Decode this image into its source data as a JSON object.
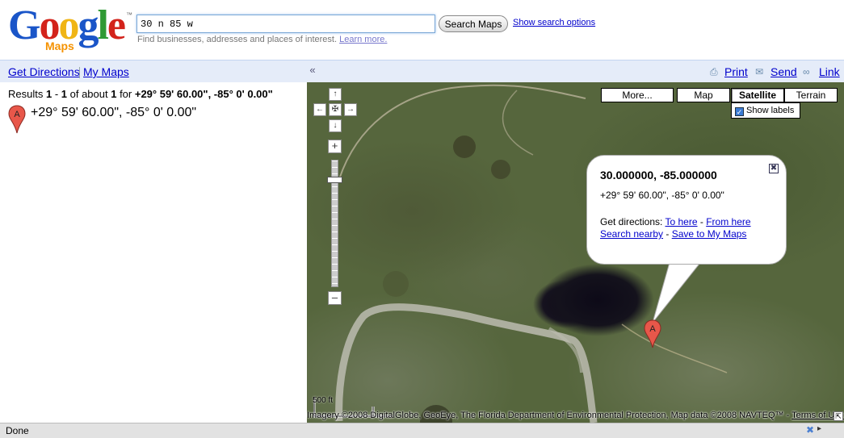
{
  "logo": {
    "text_letters": [
      "G",
      "o",
      "o",
      "g",
      "l",
      "e"
    ],
    "subtitle": "Maps",
    "trademark": "™"
  },
  "search": {
    "value": "30 n 85 w",
    "button_label": "Search Maps",
    "options_link": "Show search options",
    "hint": "Find businesses, addresses and places of interest.",
    "hint_link": "Learn more."
  },
  "left_bar": {
    "directions": "Get Directions",
    "my_maps": "My Maps"
  },
  "right_bar": {
    "collapse": "«",
    "print": "Print",
    "send": "Send",
    "link": "Link"
  },
  "results": {
    "prefix": "Results ",
    "start": "1",
    "dash": " - ",
    "end": "1",
    "middle": " of about ",
    "total": "1",
    "for_text": " for ",
    "query": "+29° 59' 60.00\", -85° 0' 0.00\"",
    "marker_letter": "A",
    "item_text": "+29° 59' 60.00\", -85° 0' 0.00\""
  },
  "map": {
    "types": {
      "more": "More...",
      "map": "Map",
      "satellite": "Satellite",
      "terrain": "Terrain"
    },
    "show_labels": "Show labels",
    "marker_letter": "A",
    "bubble": {
      "title": "30.000000, -85.000000",
      "coords": "+29° 59' 60.00\", -85° 0' 0.00\"",
      "get_directions": "Get directions: ",
      "to_here": "To here",
      "from_here": "From here",
      "search_nearby": "Search nearby",
      "save": "Save to My Maps",
      "sep": " - "
    },
    "scale_label": "500 ft",
    "copyright": "Imagery ©2008 DigitalGlobe, GeoEye, The Florida Department of Environmental Protection, Map data ©2008 NAVTEQ™ - ",
    "terms": "Terms of Use"
  },
  "status": {
    "text": "Done"
  },
  "colors": {
    "link": "#0000cc",
    "toolbar_bg": "#e5ecf9",
    "marker": "#e8574a"
  }
}
